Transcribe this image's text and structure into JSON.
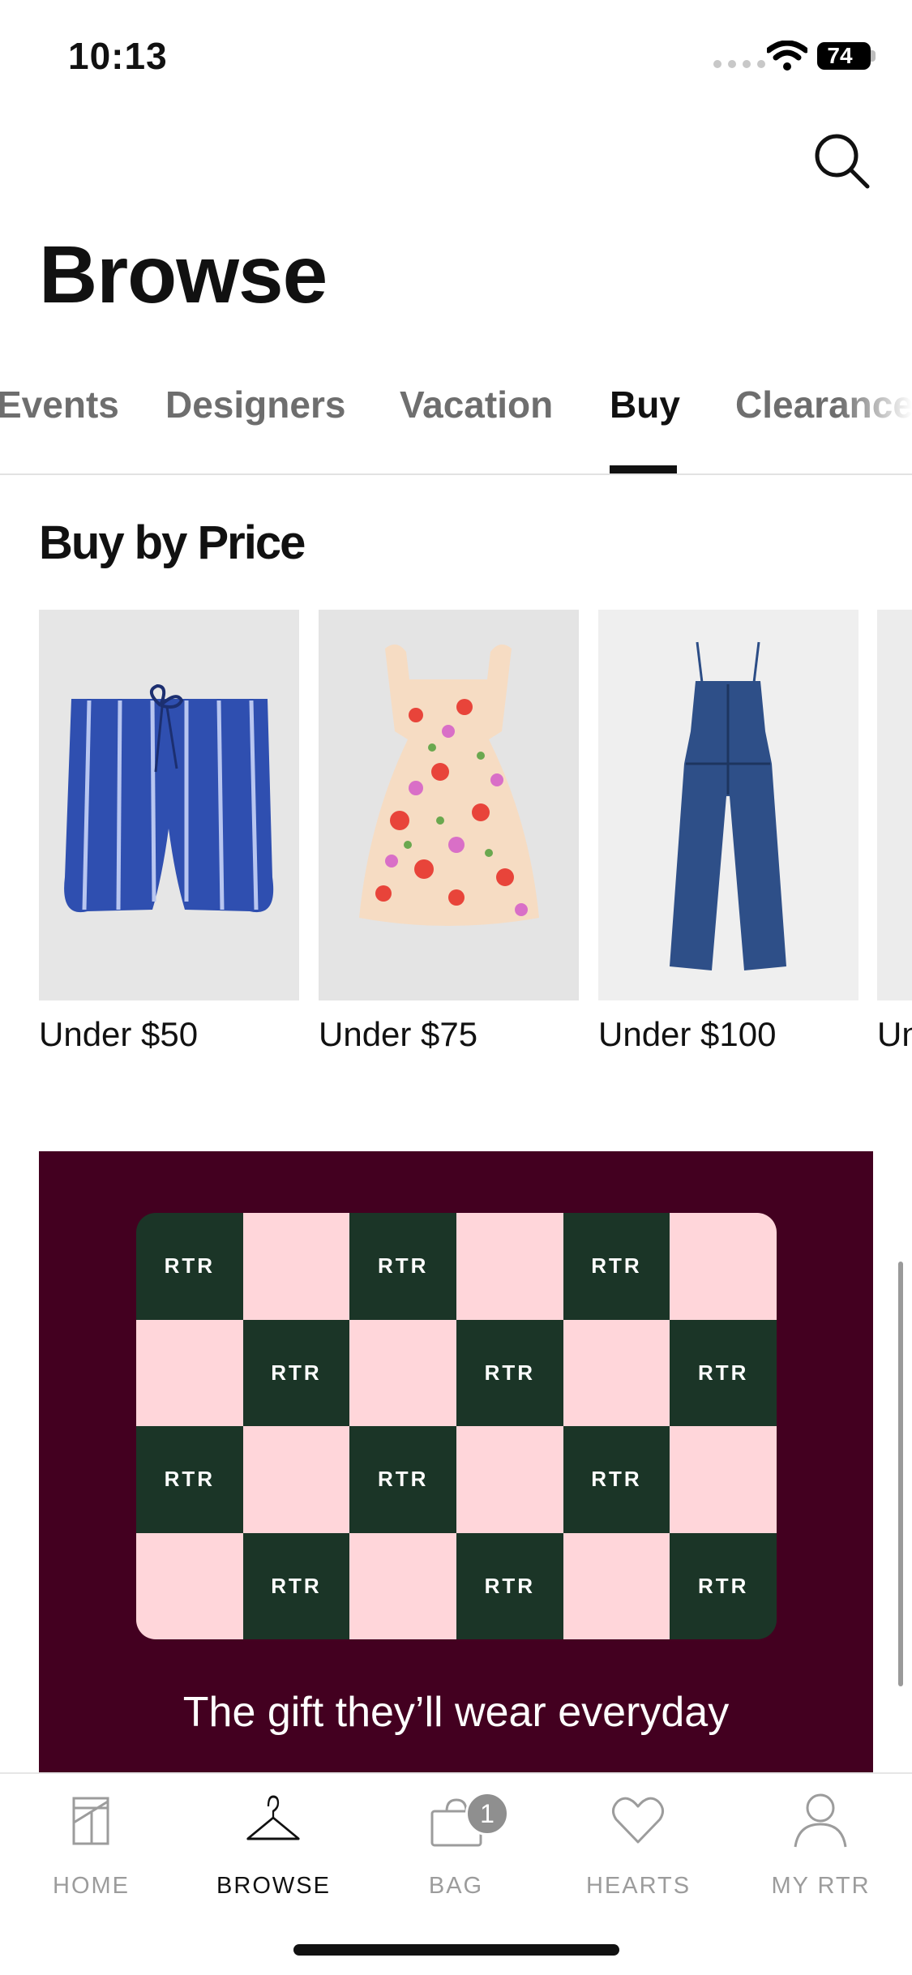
{
  "status_bar": {
    "time": "10:13",
    "battery": "74"
  },
  "header": {
    "title": "Browse",
    "search_icon": "search-icon"
  },
  "tabs": [
    {
      "label": "Events",
      "active": false
    },
    {
      "label": "Designers",
      "active": false
    },
    {
      "label": "Vacation",
      "active": false
    },
    {
      "label": "Buy",
      "active": true
    },
    {
      "label": "Clearance",
      "active": false
    }
  ],
  "buy_by_price": {
    "title": "Buy by Price",
    "items": [
      {
        "label": "Under $50",
        "image": "blue striped shorts"
      },
      {
        "label": "Under $75",
        "image": "floral ruffle dress"
      },
      {
        "label": "Under $100",
        "image": "denim jumpsuit"
      },
      {
        "label": "Un",
        "image": ""
      }
    ]
  },
  "gift_banner": {
    "cell_text": "RTR",
    "caption": "The gift they’ll wear everyday",
    "colors": {
      "background": "#430020",
      "dark": "#1b3527",
      "light": "#ffd6da"
    }
  },
  "bottom_nav": {
    "items": [
      {
        "label": "HOME",
        "icon": "home-icon",
        "active": false
      },
      {
        "label": "BROWSE",
        "icon": "hanger-icon",
        "active": true
      },
      {
        "label": "BAG",
        "icon": "bag-icon",
        "active": false,
        "badge": "1"
      },
      {
        "label": "HEARTS",
        "icon": "heart-icon",
        "active": false
      },
      {
        "label": "MY RTR",
        "icon": "user-icon",
        "active": false
      }
    ]
  }
}
